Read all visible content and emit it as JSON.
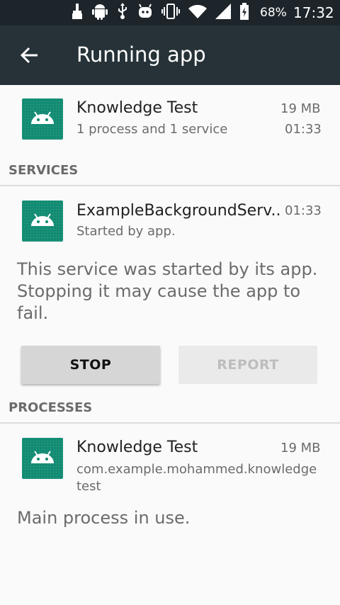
{
  "status_bar": {
    "battery": "68%",
    "time": "17:32",
    "icons": [
      "broom-icon",
      "android-icon",
      "usb-icon",
      "android-debug-icon",
      "vibrate-icon",
      "wifi-icon",
      "signal-icon",
      "battery-icon"
    ]
  },
  "app_bar": {
    "title": "Running app"
  },
  "app_row": {
    "name": "Knowledge Test",
    "subtitle": "1 process and 1 service",
    "size": "19 MB",
    "time": "01:33"
  },
  "services": {
    "header": "SERVICES",
    "item": {
      "name": "ExampleBackgroundServ..",
      "subtitle": "Started by app.",
      "time": "01:33"
    },
    "description": "This service was started by its app. Stopping it may cause the app to fail.",
    "stop_label": "STOP",
    "report_label": "REPORT"
  },
  "processes": {
    "header": "PROCESSES",
    "item": {
      "name": "Knowledge Test",
      "package": "com.example.mohammed.knowledgetest",
      "size": "19 MB"
    },
    "description": "Main process in use."
  },
  "colors": {
    "status_bar": "#1d252b",
    "app_bar": "#263238",
    "icon_bg": "#0f8a72",
    "background": "#fafafa"
  }
}
